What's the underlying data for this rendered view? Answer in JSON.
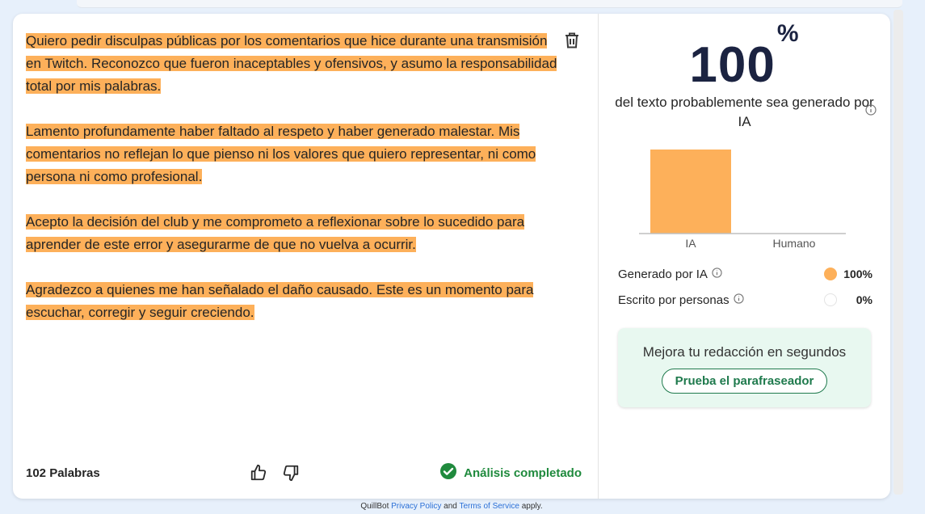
{
  "editor": {
    "paragraphs": [
      "Quiero pedir disculpas públicas por los comentarios que hice durante una transmisión en Twitch. Reconozco que fueron inaceptables y ofensivos, y asumo la responsabilidad total por mis palabras.",
      "Lamento profundamente haber faltado al respeto y haber generado malestar. Mis comentarios no reflejan lo que pienso ni los valores que quiero representar, ni como persona ni como profesional.",
      "Acepto la decisión del club y me comprometo a reflexionar sobre lo sucedido para aprender de este error y asegurarme de que no vuelva a ocurrir.",
      "Agradezco a quienes me han señalado el daño causado. Este es un momento para escuchar, corregir y seguir creciendo."
    ],
    "highlight_color": "#fdb05a",
    "word_count": "102 Palabras",
    "status": "Análisis completado",
    "status_color": "#1f8a3d"
  },
  "result": {
    "percent": "100",
    "percent_sign": "%",
    "caption": "del texto probablemente sea generado por IA",
    "breakdown": [
      {
        "label": "Generado por IA",
        "value": "100%",
        "color": "#fdb05a"
      },
      {
        "label": "Escrito por personas",
        "value": "0%",
        "color": "#ffffff"
      }
    ]
  },
  "chart_data": {
    "type": "bar",
    "categories": [
      "IA",
      "Humano"
    ],
    "values": [
      100,
      0
    ],
    "ylim": [
      0,
      100
    ],
    "colors": [
      "#fdb05a",
      "#fdb05a"
    ],
    "grid": false
  },
  "promo": {
    "title": "Mejora tu redacción en segundos",
    "button": "Prueba el parafraseador"
  },
  "legal": {
    "brand": "QuillBot",
    "privacy": "Privacy Policy",
    "and": "and",
    "terms": "Terms of Service",
    "suffix": "apply."
  }
}
